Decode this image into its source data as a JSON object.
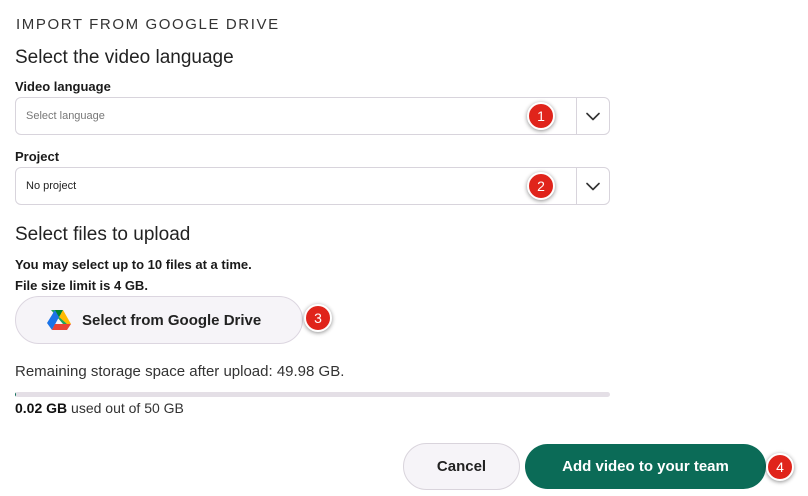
{
  "header": {
    "title": "IMPORT FROM GOOGLE DRIVE"
  },
  "language_section": {
    "title": "Select the video language"
  },
  "video_language": {
    "label": "Video language",
    "placeholder": "Select language",
    "badge": "1",
    "arrow_icon": "chevron-down-icon"
  },
  "project": {
    "label": "Project",
    "value": "No project",
    "badge": "2",
    "arrow_icon": "chevron-down-icon"
  },
  "files_section": {
    "title": "Select files to upload",
    "limit_text": "You may select up to 10 files at a time.",
    "size_text": "File size limit is 4 GB."
  },
  "drive_button": {
    "label": "Select from Google Drive",
    "icon": "google-drive-icon",
    "badge": "3"
  },
  "storage": {
    "remaining_text": "Remaining storage space after upload: 49.98 GB.",
    "used_value": "0.02 GB",
    "used_suffix": " used out of 50 GB",
    "used_fraction": 0.0004
  },
  "actions": {
    "cancel_label": "Cancel",
    "submit_label": "Add video to your team",
    "submit_badge": "4"
  },
  "colors": {
    "primary": "#0b6b57",
    "badge": "#e0241b",
    "button_bg": "#f6f4f8",
    "border": "#d8d4dc"
  }
}
